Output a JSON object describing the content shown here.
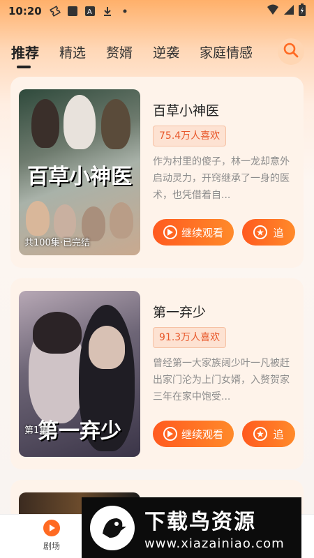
{
  "status_bar": {
    "time": "10:20"
  },
  "tabs": [
    {
      "label": "推荐",
      "active": true
    },
    {
      "label": "精选",
      "active": false
    },
    {
      "label": "赘婿",
      "active": false
    },
    {
      "label": "逆袭",
      "active": false
    },
    {
      "label": "家庭情感",
      "active": false
    }
  ],
  "colors": {
    "accent": "#ff6a22",
    "likes_text": "#e8582b"
  },
  "dramas": [
    {
      "title": "百草小神医",
      "poster_title": "百草小神医",
      "likes": "75.4万人喜欢",
      "description": "作为村里的傻子，林一龙却意外启动灵力，开窍继承了一身的医术，也凭借着自...",
      "badge": "共100集·已完结",
      "watch_label": "继续观看",
      "follow_label": "追"
    },
    {
      "title": "第一弃少",
      "poster_title": "第一弃少",
      "likes": "91.3万人喜欢",
      "description": "曾经第一大家族阔少叶一凡被赶出家门沦为上门女婿，入赘贺家三年在家中饱受...",
      "badge": "第1集",
      "watch_label": "继续观看",
      "follow_label": "追"
    }
  ],
  "bottom_nav": {
    "home_label": "剧场"
  },
  "watermark": {
    "title": "下载鸟资源",
    "url": "www.xiazainiao.com"
  }
}
